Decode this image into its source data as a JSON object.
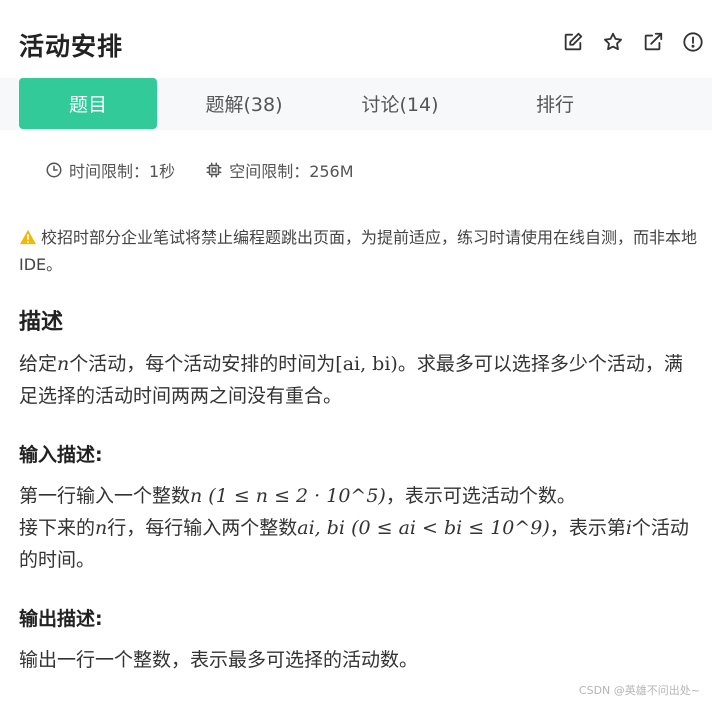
{
  "header": {
    "title": "活动安排",
    "icons": [
      "edit-icon",
      "star-icon",
      "open-external-icon",
      "report-icon"
    ]
  },
  "tabs": [
    {
      "label": "题目",
      "active": true
    },
    {
      "label": "题解(38)",
      "active": false
    },
    {
      "label": "讨论(14)",
      "active": false
    },
    {
      "label": "排行",
      "active": false
    }
  ],
  "limits": {
    "time": "时间限制：1秒",
    "memory": "空间限制：256M"
  },
  "notice": "校招时部分企业笔试将禁止编程题跳出页面，为提前适应，练习时请使用在线自测，而非本地IDE。",
  "description": {
    "heading": "描述",
    "text_1": "给定",
    "var_n": "n",
    "text_2": "个活动，每个活动安排的时间为",
    "interval": "[ai, bi)",
    "text_3": "。求最多可以选择多少个活动，满足选择的活动时间两两之间没有重合。"
  },
  "input": {
    "heading": "输入描述:",
    "line1_a": "第一行输入一个整数",
    "line1_math": "n (1 ≤ n ≤ 2 · 10^5)",
    "line1_b": "，表示可选活动个数。",
    "line2_a": "接下来的",
    "line2_b": "行，每行输入两个整数",
    "line2_math_vars": "ai, bi",
    "line2_math_range": "(0 ≤ ai < bi ≤ 10^9)",
    "line2_c": "，表示第",
    "line2_var_i": "i",
    "line2_d": "个活动的时间。"
  },
  "output": {
    "heading": "输出描述:",
    "text": "输出一行一个整数，表示最多可选择的活动数。"
  },
  "watermark": "CSDN @英雄不问出处~",
  "colors": {
    "accent": "#32ca99",
    "warn": "#f5b800"
  }
}
